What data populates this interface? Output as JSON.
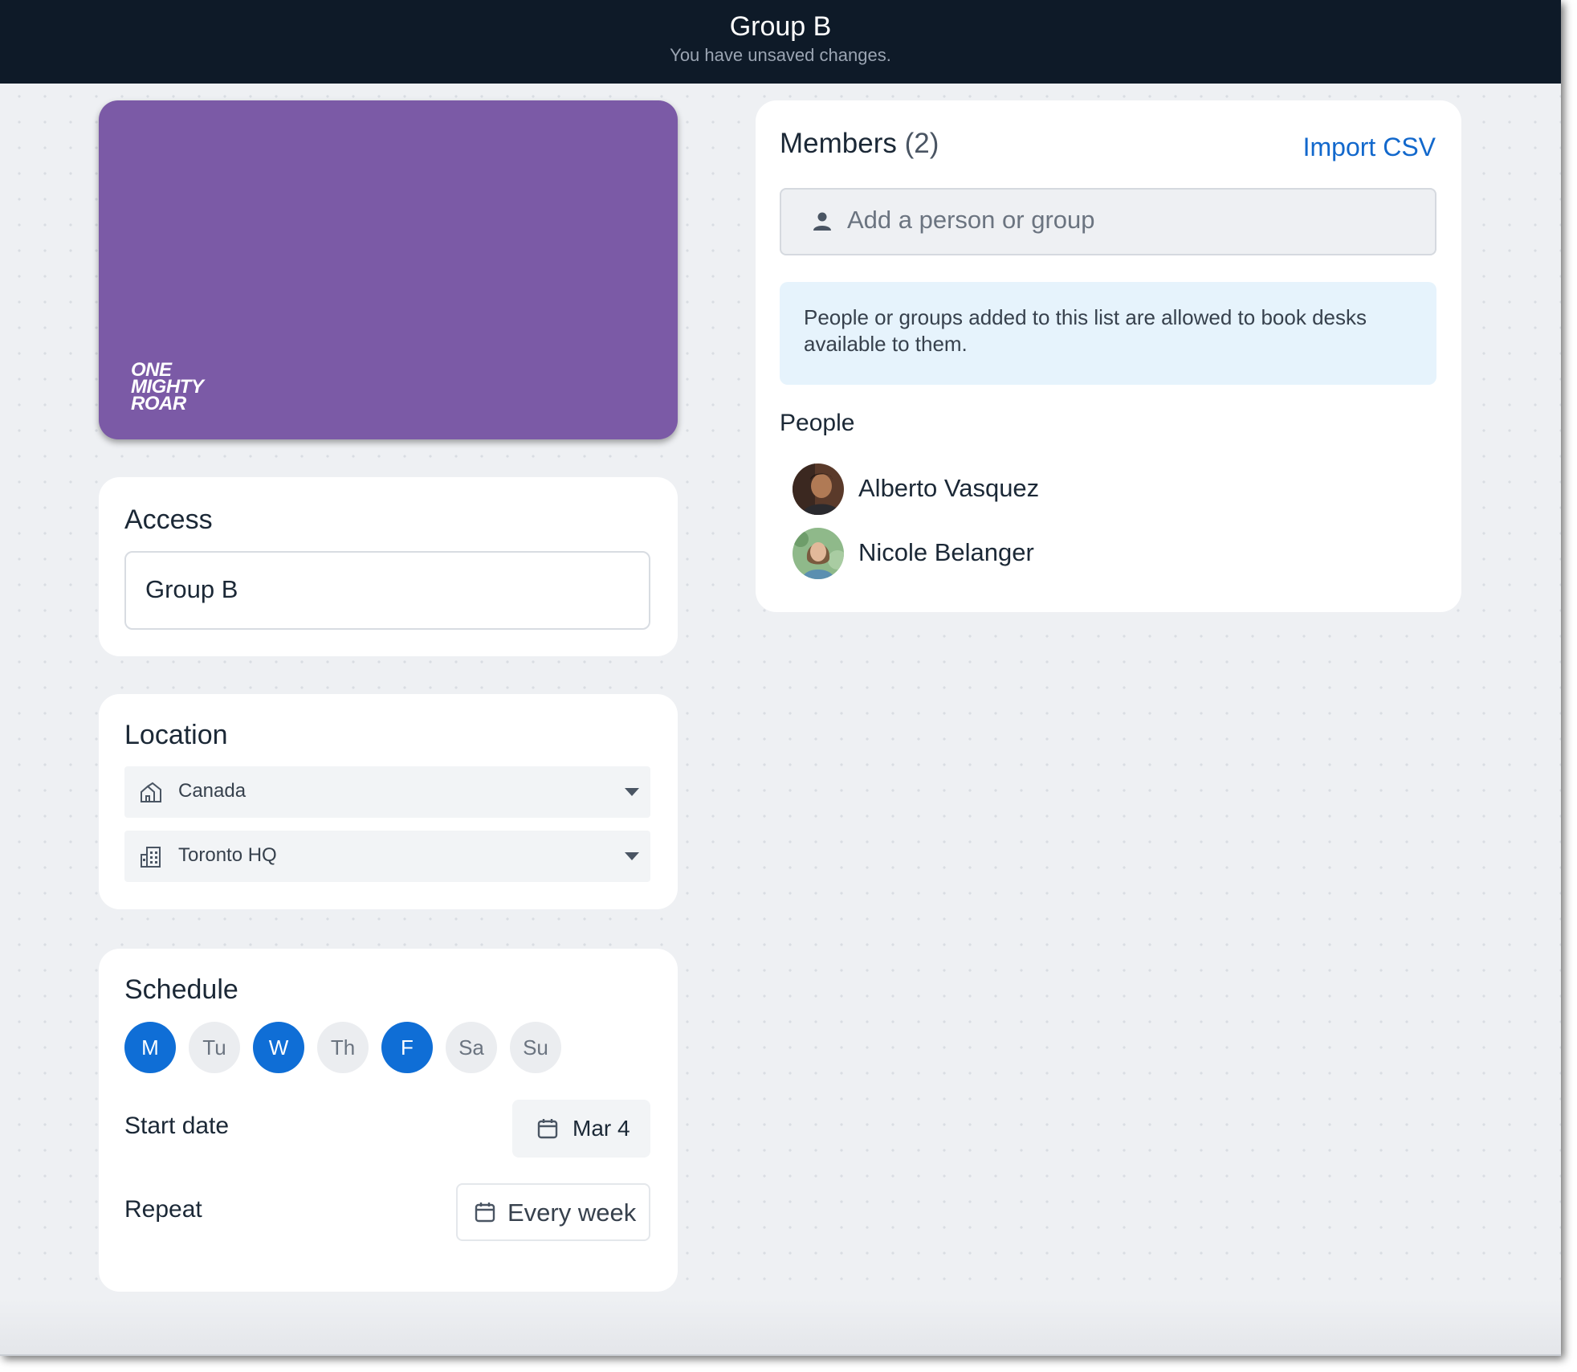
{
  "header": {
    "title": "Group B",
    "subtitle": "You have unsaved changes."
  },
  "brand": {
    "logo_lines": [
      "ONE",
      "MIGHTY",
      "ROAR"
    ],
    "card_color": "#7b5aa6"
  },
  "access": {
    "title": "Access",
    "name_value": "Group B"
  },
  "location": {
    "title": "Location",
    "region": {
      "icon": "region-icon",
      "value": "Canada"
    },
    "building": {
      "icon": "building-icon",
      "value": "Toronto HQ"
    }
  },
  "schedule": {
    "title": "Schedule",
    "days": [
      {
        "label": "M",
        "selected": true
      },
      {
        "label": "Tu",
        "selected": false
      },
      {
        "label": "W",
        "selected": true
      },
      {
        "label": "Th",
        "selected": false
      },
      {
        "label": "F",
        "selected": true
      },
      {
        "label": "Sa",
        "selected": false
      },
      {
        "label": "Su",
        "selected": false
      }
    ],
    "start_date_label": "Start date",
    "start_date_value": "Mar 4",
    "repeat_label": "Repeat",
    "repeat_value": "Every week",
    "accent_color": "#0f6ed6"
  },
  "members": {
    "title": "Members",
    "count": "(2)",
    "import_label": "Import CSV",
    "add_placeholder": "Add a person or group",
    "info_text": "People or groups added to this list are allowed to book desks available to them.",
    "people_label": "People",
    "people": [
      {
        "name": "Alberto Vasquez"
      },
      {
        "name": "Nicole Belanger"
      }
    ]
  }
}
